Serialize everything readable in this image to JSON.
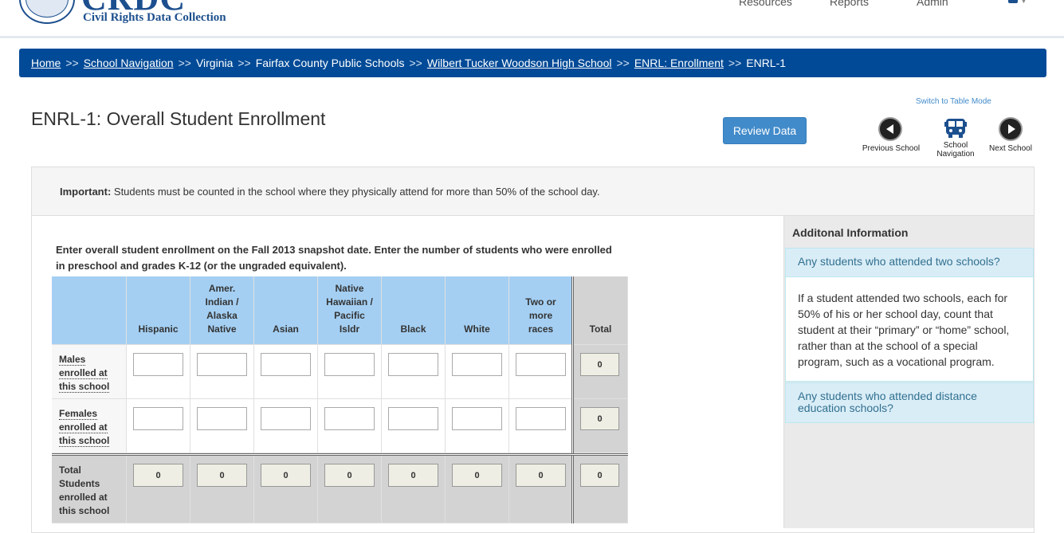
{
  "header": {
    "logo_main": "CRDC",
    "logo_sub": "Civil Rights Data Collection",
    "nav": [
      "Resources",
      "Reports",
      "Admin"
    ]
  },
  "breadcrumb": {
    "items": [
      {
        "label": "Home",
        "link": true
      },
      {
        "label": "School Navigation",
        "link": true
      },
      {
        "label": "Virginia",
        "link": false
      },
      {
        "label": "Fairfax County Public Schools",
        "link": false
      },
      {
        "label": "Wilbert Tucker Woodson High School",
        "link": true
      },
      {
        "label": "ENRL: Enrollment",
        "link": true
      },
      {
        "label": "ENRL-1",
        "link": false
      }
    ],
    "separator": ">>"
  },
  "page": {
    "title": "ENRL-1: Overall Student Enrollment",
    "review_button": "Review Data",
    "switch_link": "Switch to Table Mode",
    "prev_label": "Previous School",
    "school_nav_label_1": "School",
    "school_nav_label_2": "Navigation",
    "next_label": "Next School"
  },
  "important": {
    "label": "Important:",
    "text": " Students must be counted in the school where they physically attend for more than 50% of the school day."
  },
  "instructions": "Enter overall student enrollment on the Fall 2013 snapshot date. Enter the number of students who were enrolled in preschool and grades K-12 (or the ungraded equivalent).",
  "grid": {
    "columns": [
      {
        "lines": [
          "Hispanic"
        ]
      },
      {
        "lines": [
          "Amer.",
          "Indian /",
          "Alaska",
          "Native"
        ]
      },
      {
        "lines": [
          "Asian"
        ]
      },
      {
        "lines": [
          "Native",
          "Hawaiian /",
          "Pacific",
          "Isldr"
        ]
      },
      {
        "lines": [
          "Black"
        ]
      },
      {
        "lines": [
          "White"
        ]
      },
      {
        "lines": [
          "Two or",
          "more",
          "races"
        ]
      }
    ],
    "total_header": "Total",
    "rows": [
      {
        "lines": [
          "Males",
          "enrolled at",
          "this school"
        ],
        "total": "0"
      },
      {
        "lines": [
          "Females",
          "enrolled at",
          "this school"
        ],
        "total": "0"
      }
    ],
    "total_row": {
      "lines": [
        "Total",
        "Students",
        "enrolled at",
        "this school"
      ],
      "values": [
        "0",
        "0",
        "0",
        "0",
        "0",
        "0",
        "0"
      ],
      "grand_total": "0"
    }
  },
  "side": {
    "title": "Additonal Information",
    "q1": "Any students who attended two schools?",
    "a1": "If a student attended two schools, each for 50% of his or her school day, count that student at their “primary” or “home” school, rather than at the school of a special program, such as a vocational program.",
    "q2": "Any students who attended distance education schools?"
  }
}
